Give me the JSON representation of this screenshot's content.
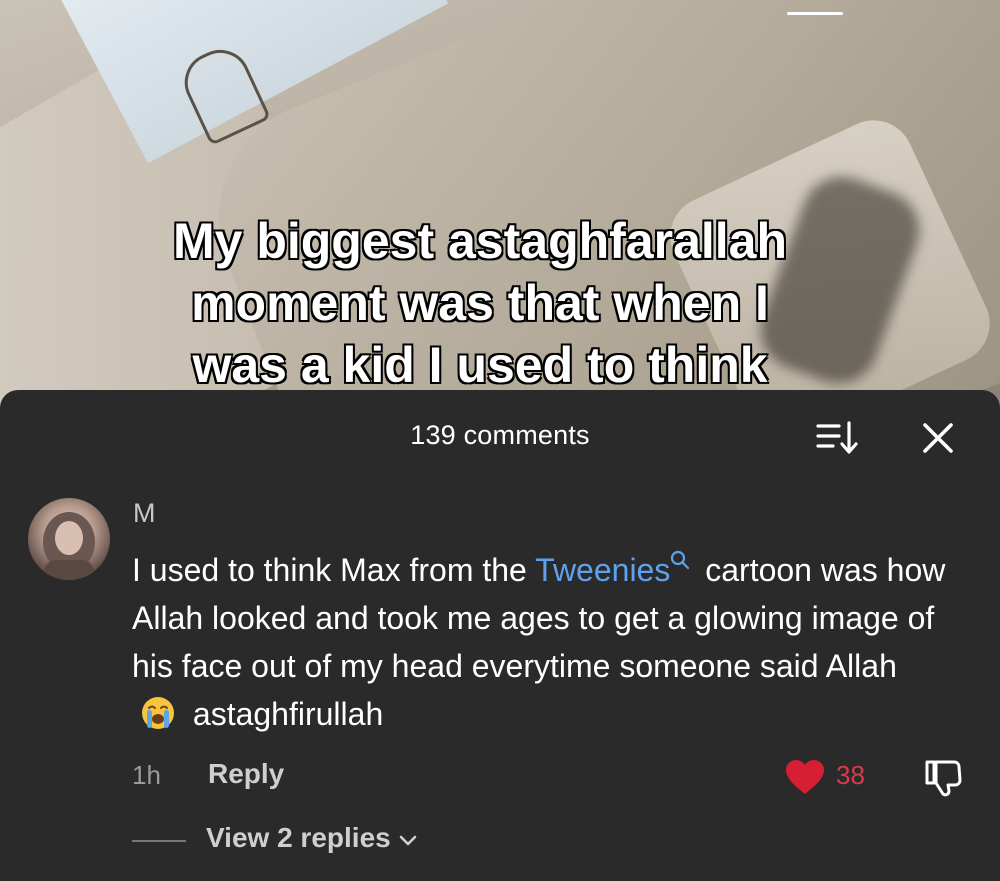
{
  "video": {
    "caption_lines": [
      "My biggest astaghfarallah",
      "moment was that when I",
      "was a kid I used to think"
    ]
  },
  "sheet": {
    "comment_count": "139 comments",
    "sort_icon": "sort-icon",
    "close_icon": "close-icon"
  },
  "comment": {
    "author": "M",
    "text_before": "I used to think Max from the ",
    "mention": "Tweenies",
    "text_middle": " cartoon was how Allah looked and took me ages to get a glowing image of his face out of my head everytime someone said Allah ",
    "emoji": "loudly-crying-face",
    "text_after": " astaghfirullah",
    "timestamp": "1h",
    "reply_label": "Reply",
    "likes": "38",
    "view_replies": "View 2 replies"
  },
  "colors": {
    "sheet_bg": "#2a2a2a",
    "mention": "#5ea2ef",
    "like": "#d63b4a"
  }
}
